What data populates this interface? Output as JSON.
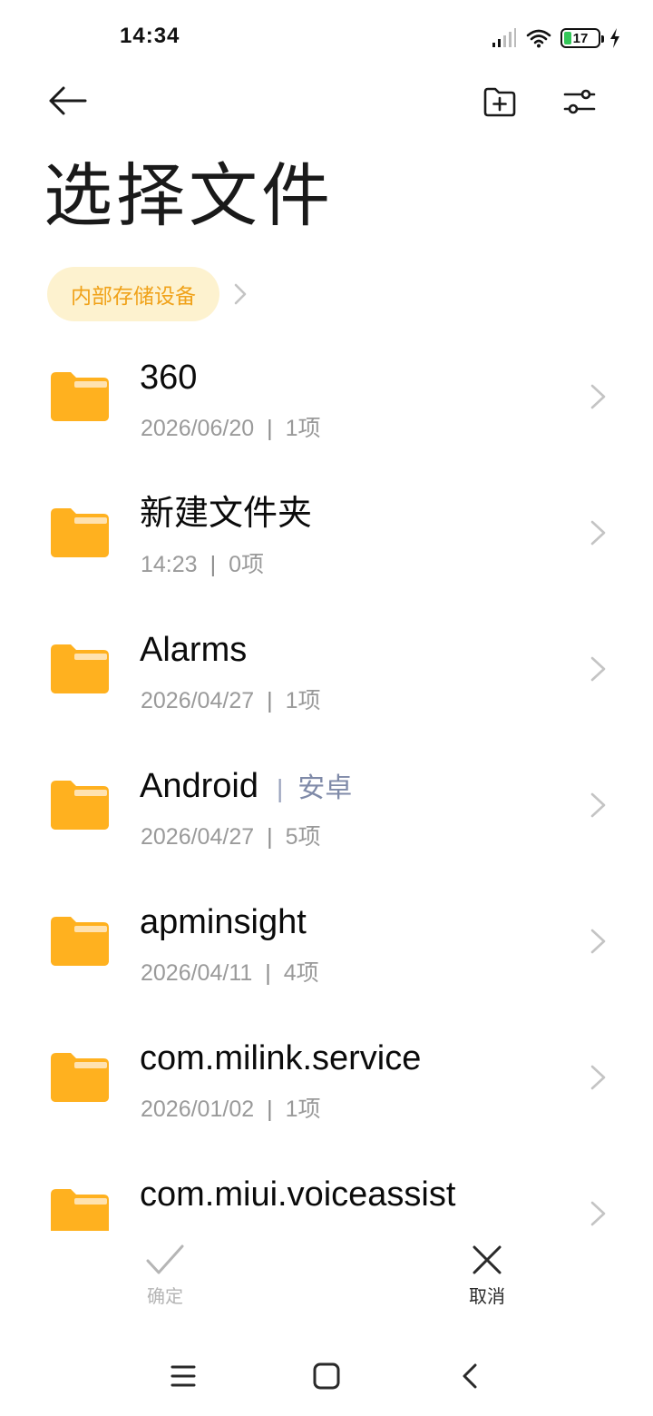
{
  "status_bar": {
    "time": "14:34",
    "battery": "17",
    "icons": [
      "signal-icon",
      "wifi-icon",
      "battery-icon",
      "charging-icon"
    ]
  },
  "toolbar": {
    "icons": [
      "back-arrow-icon",
      "new-folder-icon",
      "sort-settings-icon"
    ]
  },
  "page_title": "选择文件",
  "breadcrumb": {
    "current": "内部存储设备"
  },
  "folders": [
    {
      "name": "360",
      "tag": "",
      "date": "2026/06/20",
      "count": "1项"
    },
    {
      "name": "新建文件夹",
      "tag": "",
      "date": "14:23",
      "count": "0项"
    },
    {
      "name": "Alarms",
      "tag": "",
      "date": "2026/04/27",
      "count": "1项"
    },
    {
      "name": "Android",
      "tag": "安卓",
      "date": "2026/04/27",
      "count": "5项"
    },
    {
      "name": "apminsight",
      "tag": "",
      "date": "2026/04/11",
      "count": "4项"
    },
    {
      "name": "com.milink.service",
      "tag": "",
      "date": "2026/01/02",
      "count": "1项"
    },
    {
      "name": "com.miui.voiceassist",
      "tag": "",
      "date": "",
      "count": ""
    }
  ],
  "actions": {
    "confirm_label": "确定",
    "cancel_label": "取消"
  },
  "colors": {
    "folder": "#ffb11f",
    "folder_tab": "#ffe2b0",
    "chip_bg": "#fdf2cf",
    "chip_text": "#f0a21a",
    "tag": "#7f8aa8"
  }
}
